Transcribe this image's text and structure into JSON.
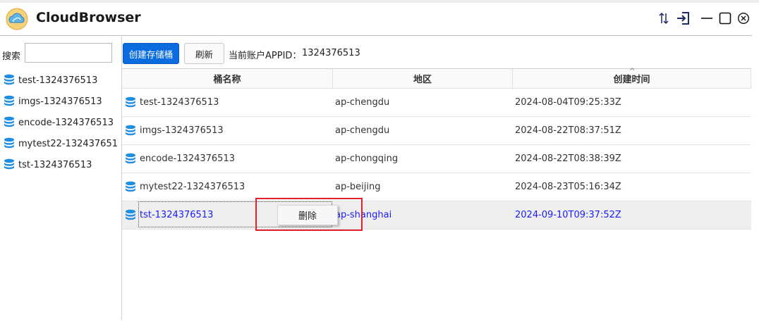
{
  "window": {
    "title": "CloudBrowser",
    "logo_icon": "cloud-icon",
    "controls": [
      "sort-icon",
      "login-icon",
      "minimize-icon",
      "maximize-icon",
      "close-icon"
    ]
  },
  "sidebar": {
    "search_label": "搜索",
    "search_value": "",
    "items": [
      {
        "label": "test-1324376513",
        "icon": "database-icon"
      },
      {
        "label": "imgs-1324376513",
        "icon": "database-icon"
      },
      {
        "label": "encode-1324376513",
        "icon": "database-icon"
      },
      {
        "label": "mytest22-132437651",
        "icon": "database-icon"
      },
      {
        "label": "tst-1324376513",
        "icon": "database-icon"
      }
    ]
  },
  "toolbar": {
    "create_label": "创建存储桶",
    "refresh_label": "刷新",
    "appid_label": "当前账户APPID：",
    "appid_value": "1324376513"
  },
  "table": {
    "columns": [
      "桶名称",
      "地区",
      "创建时间"
    ],
    "sort_indicator": "^",
    "rows": [
      {
        "name": "test-1324376513",
        "region": "ap-chengdu",
        "created": "2024-08-04T09:25:33Z"
      },
      {
        "name": "imgs-1324376513",
        "region": "ap-chengdu",
        "created": "2024-08-22T08:37:51Z"
      },
      {
        "name": "encode-1324376513",
        "region": "ap-chongqing",
        "created": "2024-08-22T08:38:39Z"
      },
      {
        "name": "mytest22-1324376513",
        "region": "ap-beijing",
        "created": "2024-08-23T05:16:34Z"
      },
      {
        "name": "tst-1324376513",
        "region": "ap-shanghai",
        "created": "2024-09-10T09:37:52Z"
      }
    ],
    "selected_row": 5
  },
  "context_menu": {
    "items": [
      "删除"
    ]
  },
  "colors": {
    "accent": "#0b6ce0",
    "selected_text": "#1a1aff",
    "highlight_border": "#e0202a",
    "db_icon": "#1f8ee0"
  }
}
